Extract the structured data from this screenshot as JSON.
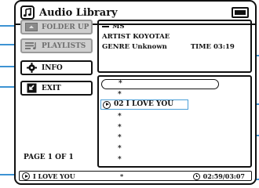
{
  "window": {
    "title": "Audio Library",
    "app_icon": "music-note-icon",
    "battery_icon": "battery-icon"
  },
  "sidebar": {
    "folder_up": {
      "label": "FOLDER UP",
      "icon": "folder-icon",
      "enabled": false
    },
    "playlists": {
      "label": "PLAYLISTS",
      "icon": "playlist-icon",
      "enabled": false
    },
    "info": {
      "label": "INFO",
      "icon": "info-gear-icon",
      "enabled": true
    },
    "exit": {
      "label": "EXIT",
      "icon": "exit-icon",
      "enabled": true
    },
    "page_info": "PAGE 1 OF 1"
  },
  "info_panel": {
    "folder": "MS",
    "artist_line": "ARTIST KOYOTAE",
    "genre_line": "GENRE Unknown",
    "time_line": "TIME 03:19"
  },
  "track_list": {
    "items": [
      {
        "label": "*",
        "state": "focused"
      },
      {
        "label": "*",
        "state": "normal"
      },
      {
        "label": "02 I LOVE YOU",
        "state": "playing"
      },
      {
        "label": "*",
        "state": "normal"
      },
      {
        "label": "*",
        "state": "normal"
      },
      {
        "label": "*",
        "state": "normal"
      },
      {
        "label": "*",
        "state": "normal"
      },
      {
        "label": "*",
        "state": "normal"
      }
    ]
  },
  "status_bar": {
    "now_playing": "I LOVE YOU",
    "marker": "*",
    "elapsed_total": "02:59/03:07"
  },
  "colors": {
    "border": "#111111",
    "disabled_fill": "#cfcfcf",
    "disabled_text": "#6f6f6f",
    "callout": "#3d93d3"
  }
}
